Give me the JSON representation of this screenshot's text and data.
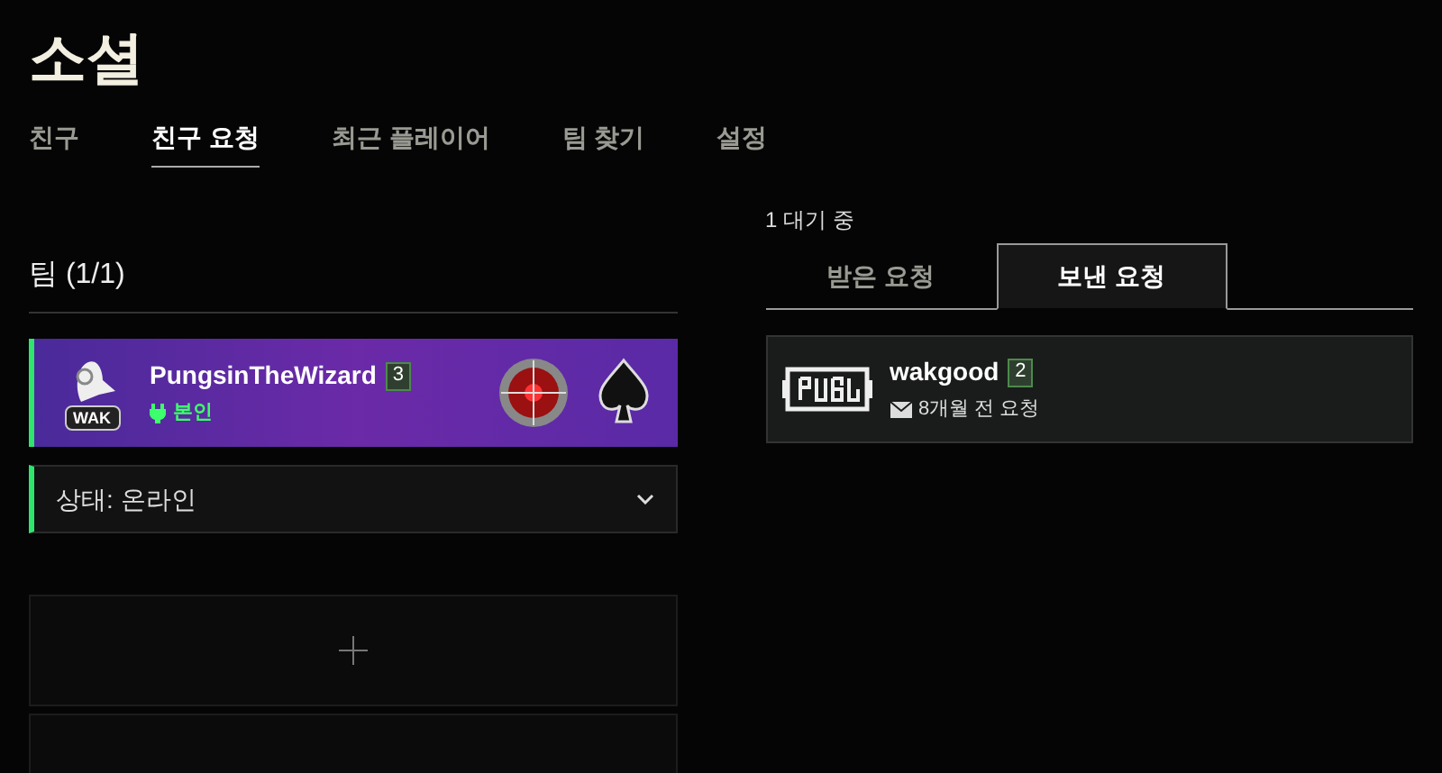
{
  "title": "소셜",
  "tabs": [
    {
      "label": "친구",
      "selected": false
    },
    {
      "label": "친구 요청",
      "selected": true
    },
    {
      "label": "최근 플레이어",
      "selected": false
    },
    {
      "label": "팀 찾기",
      "selected": false
    },
    {
      "label": "설정",
      "selected": false
    }
  ],
  "team": {
    "heading": "팀 (1/1)",
    "members": [
      {
        "name": "PungsinTheWizard",
        "rank": "3",
        "tag": "본인",
        "badge": "WAK"
      }
    ],
    "status": {
      "label": "상태: 온라인"
    },
    "slots": [
      {
        "kind": "add"
      },
      {
        "kind": "empty"
      }
    ]
  },
  "requests": {
    "pending": "1 대기 중",
    "tabs": [
      {
        "label": "받은 요청",
        "selected": false
      },
      {
        "label": "보낸 요청",
        "selected": true
      }
    ],
    "items": [
      {
        "name": "wakgood",
        "rank": "2",
        "time": "8개월 전 요청"
      }
    ]
  }
}
